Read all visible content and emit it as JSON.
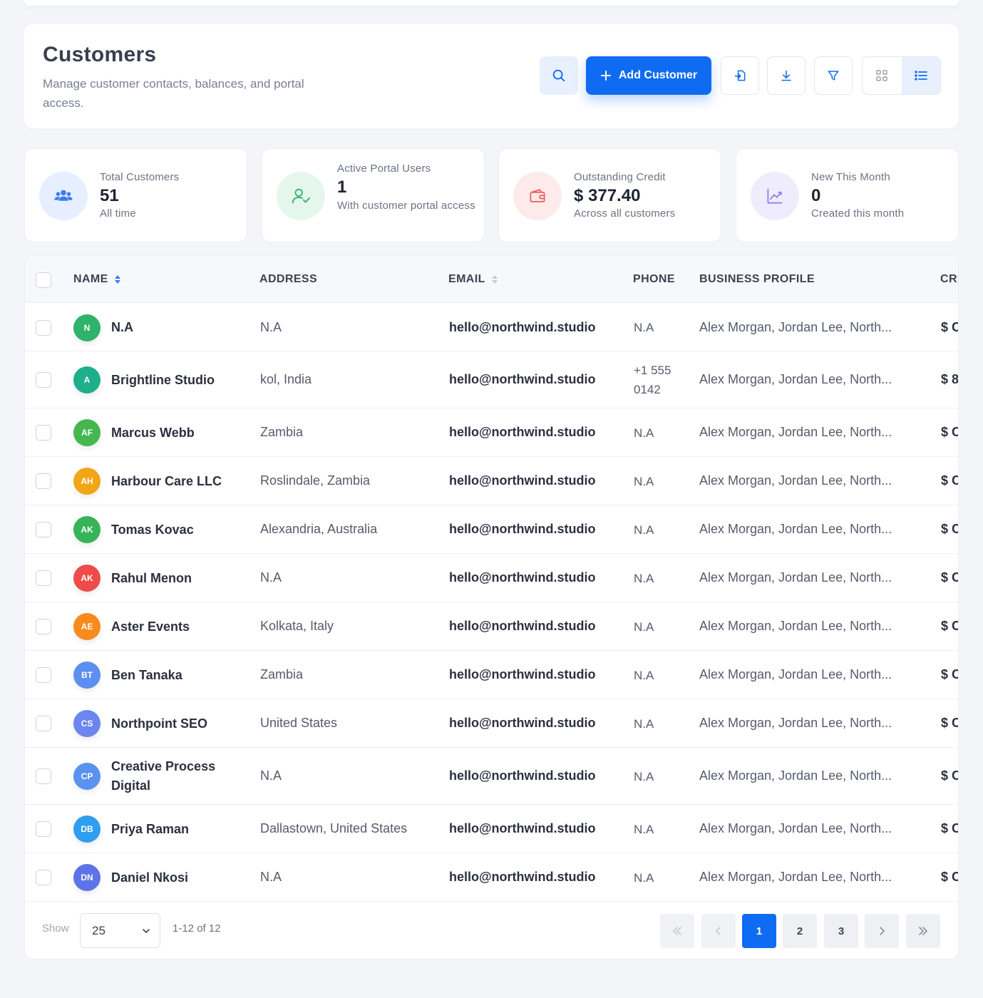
{
  "header": {
    "title": "Customers",
    "subtitle": "Manage customer contacts, balances, and portal access.",
    "add_label": "Add Customer",
    "colors": {
      "primary": "#0f6cf2",
      "primary_light": "#e8f0fd"
    }
  },
  "stats": [
    {
      "label": "Total Customers",
      "value": "51",
      "sub": "All time",
      "icon": "users-icon",
      "color": "#3b7bf0"
    },
    {
      "label": "Active Portal Users",
      "value": "1",
      "sub": "With customer portal access",
      "icon": "user-check-icon",
      "color": "#2fb36a"
    },
    {
      "label": "Outstanding Credit",
      "value": "$ 377.40",
      "sub": "Across all customers",
      "icon": "wallet-icon",
      "color": "#ef5b5b"
    },
    {
      "label": "New This Month",
      "value": "0",
      "sub": "Created this month",
      "icon": "chart-line-icon",
      "color": "#8a7cf0"
    }
  ],
  "table": {
    "columns": {
      "name": "NAME",
      "address": "ADDRESS",
      "email": "EMAIL",
      "phone": "PHONE",
      "business": "BUSINESS PROFILE",
      "credit": "CRI"
    },
    "rows": [
      {
        "initials": "N",
        "name": "N.A",
        "address": "N.A",
        "email": "hello@northwind.studio",
        "phone": "N.A",
        "business": "Alex Morgan, Jordan Lee, North...",
        "credit": "$ C",
        "avatar_color": "#2fb36a"
      },
      {
        "initials": "A",
        "name": "Brightline Studio",
        "address": "kol, India",
        "email": "hello@northwind.studio",
        "phone": "+1 555 0142",
        "business": "Alex Morgan, Jordan Lee, North...",
        "credit": "$ 8",
        "avatar_color": "#1fae8a"
      },
      {
        "initials": "AF",
        "name": "Marcus Webb",
        "address": "Zambia",
        "email": "hello@northwind.studio",
        "phone": "N.A",
        "business": "Alex Morgan, Jordan Lee, North...",
        "credit": "$ C",
        "avatar_color": "#44b84f"
      },
      {
        "initials": "AH",
        "name": "Harbour Care LLC",
        "address": "Roslindale, Zambia",
        "email": "hello@northwind.studio",
        "phone": "N.A",
        "business": "Alex Morgan, Jordan Lee, North...",
        "credit": "$ C",
        "avatar_color": "#f2a516"
      },
      {
        "initials": "AK",
        "name": "Tomas Kovac",
        "address": "Alexandria, Australia",
        "email": "hello@northwind.studio",
        "phone": "N.A",
        "business": "Alex Morgan, Jordan Lee, North...",
        "credit": "$ C",
        "avatar_color": "#37b457"
      },
      {
        "initials": "AK",
        "name": "Rahul Menon",
        "address": "N.A",
        "email": "hello@northwind.studio",
        "phone": "N.A",
        "business": "Alex Morgan, Jordan Lee, North...",
        "credit": "$ C",
        "avatar_color": "#ee4b4b"
      },
      {
        "initials": "AE",
        "name": "Aster Events",
        "address": "Kolkata, Italy",
        "email": "hello@northwind.studio",
        "phone": "N.A",
        "business": "Alex Morgan, Jordan Lee, North...",
        "credit": "$ C",
        "avatar_color": "#f78b1e"
      },
      {
        "initials": "BT",
        "name": "Ben Tanaka",
        "address": "Zambia",
        "email": "hello@northwind.studio",
        "phone": "N.A",
        "business": "Alex Morgan, Jordan Lee, North...",
        "credit": "$ C",
        "avatar_color": "#5c8ff0"
      },
      {
        "initials": "CS",
        "name": "Northpoint SEO",
        "address": "United States",
        "email": "hello@northwind.studio",
        "phone": "N.A",
        "business": "Alex Morgan, Jordan Lee, North...",
        "credit": "$ C",
        "avatar_color": "#6b86ee"
      },
      {
        "initials": "CP",
        "name": "Creative Process Digital",
        "address": "N.A",
        "email": "hello@northwind.studio",
        "phone": "N.A",
        "business": "Alex Morgan, Jordan Lee, North...",
        "credit": "$ C",
        "avatar_color": "#5a92f0"
      },
      {
        "initials": "DB",
        "name": "Priya Raman",
        "address": "Dallastown, United States",
        "email": "hello@northwind.studio",
        "phone": "N.A",
        "business": "Alex Morgan, Jordan Lee, North...",
        "credit": "$ C",
        "avatar_color": "#2f9ef0"
      },
      {
        "initials": "DN",
        "name": "Daniel Nkosi",
        "address": "N.A",
        "email": "hello@northwind.studio",
        "phone": "N.A",
        "business": "Alex Morgan, Jordan Lee, North...",
        "credit": "$ C",
        "avatar_color": "#5d73e8"
      }
    ]
  },
  "footer": {
    "show_label": "Show",
    "page_size": "25",
    "range": "1-12 of 12",
    "pages": [
      "1",
      "2",
      "3"
    ],
    "current_page": "1"
  }
}
